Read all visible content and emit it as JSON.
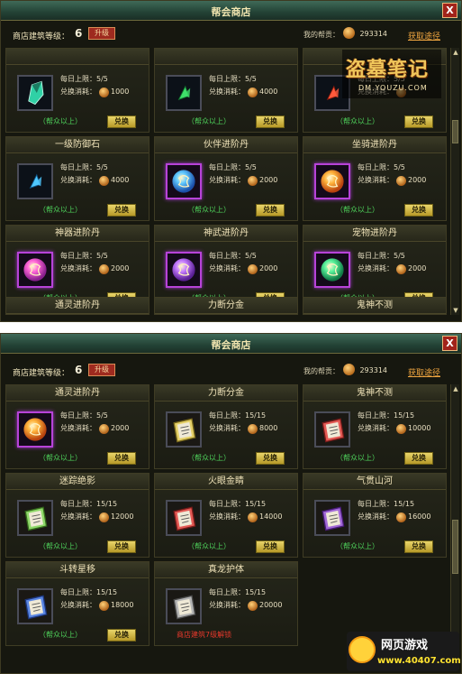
{
  "panel1": {
    "title": "帮会商店",
    "close_label": "X",
    "level_label": "商店建筑等级：",
    "level_value": "6",
    "upgrade_label": "升级",
    "money_label": "我的帮贡：",
    "money_value": "293314",
    "gain_link": "获取途径",
    "cells": [
      {
        "name": "",
        "limit": "每日上限：5/5",
        "cost_label": "兑换消耗：",
        "cost": "1000",
        "req": "（帮众以上）",
        "buy": "兑换",
        "icon": "crystal-icon",
        "frame": "plain"
      },
      {
        "name": "",
        "limit": "每日上限：5/5",
        "cost_label": "兑换消耗：",
        "cost": "4000",
        "req": "（帮众以上）",
        "buy": "兑换",
        "icon": "green-shard-icon",
        "frame": "plain"
      },
      {
        "name": "",
        "limit": "每日上限：5/5",
        "cost_label": "兑换消耗：",
        "cost": "",
        "req": "（帮众以上）",
        "buy": "兑换",
        "icon": "red-shard-icon",
        "frame": "plain"
      },
      {
        "name": "一级防御石",
        "limit": "每日上限：5/5",
        "cost_label": "兑换消耗：",
        "cost": "4000",
        "req": "（帮众以上）",
        "buy": "兑换",
        "icon": "blue-shard-icon",
        "frame": "plain"
      },
      {
        "name": "伙伴进阶丹",
        "limit": "每日上限：5/5",
        "cost_label": "兑换消耗：",
        "cost": "2000",
        "req": "（帮众以上）",
        "buy": "兑换",
        "icon": "blue-orb-icon",
        "frame": "purple"
      },
      {
        "name": "坐骑进阶丹",
        "limit": "每日上限：5/5",
        "cost_label": "兑换消耗：",
        "cost": "2000",
        "req": "（帮众以上）",
        "buy": "兑换",
        "icon": "orange-orb-icon",
        "frame": "purple"
      },
      {
        "name": "神器进阶丹",
        "limit": "每日上限：5/5",
        "cost_label": "兑换消耗：",
        "cost": "2000",
        "req": "（帮众以上）",
        "buy": "兑换",
        "icon": "magenta-orb-icon",
        "frame": "purple"
      },
      {
        "name": "神武进阶丹",
        "limit": "每日上限：5/5",
        "cost_label": "兑换消耗：",
        "cost": "2000",
        "req": "（帮众以上）",
        "buy": "兑换",
        "icon": "violet-orb-icon",
        "frame": "purple"
      },
      {
        "name": "宠物进阶丹",
        "limit": "每日上限：5/5",
        "cost_label": "兑换消耗：",
        "cost": "2000",
        "req": "（帮众以上）",
        "buy": "兑换",
        "icon": "green-orb-icon",
        "frame": "purple"
      }
    ],
    "partial_heads": [
      "通灵进阶丹",
      "力断分金",
      "鬼神不测"
    ]
  },
  "logo": {
    "main": "盗墓笔记",
    "sub": "DM.YOUZU.COM"
  },
  "panel2": {
    "title": "帮会商店",
    "close_label": "X",
    "level_label": "商店建筑等级：",
    "level_value": "6",
    "upgrade_label": "升级",
    "money_label": "我的帮贡：",
    "money_value": "293314",
    "gain_link": "获取途径",
    "cells": [
      {
        "name": "通灵进阶丹",
        "limit": "每日上限：5/5",
        "cost_label": "兑换消耗：",
        "cost": "2000",
        "req": "（帮众以上）",
        "buy": "兑换",
        "icon": "orange-orb-icon",
        "frame": "purple"
      },
      {
        "name": "力断分金",
        "limit": "每日上限：15/15",
        "cost_label": "兑换消耗：",
        "cost": "8000",
        "req": "（帮众以上）",
        "buy": "兑换",
        "icon": "yellow-book-icon",
        "frame": "plain"
      },
      {
        "name": "鬼神不测",
        "limit": "每日上限：15/15",
        "cost_label": "兑换消耗：",
        "cost": "10000",
        "req": "（帮众以上）",
        "buy": "兑换",
        "icon": "red-book-icon",
        "frame": "plain"
      },
      {
        "name": "迷踪绝影",
        "limit": "每日上限：15/15",
        "cost_label": "兑换消耗：",
        "cost": "12000",
        "req": "（帮众以上）",
        "buy": "兑换",
        "icon": "green-book-icon",
        "frame": "plain"
      },
      {
        "name": "火眼金睛",
        "limit": "每日上限：15/15",
        "cost_label": "兑换消耗：",
        "cost": "14000",
        "req": "（帮众以上）",
        "buy": "兑换",
        "icon": "red-book-icon",
        "frame": "plain"
      },
      {
        "name": "气贯山河",
        "limit": "每日上限：15/15",
        "cost_label": "兑换消耗：",
        "cost": "16000",
        "req": "（帮众以上）",
        "buy": "兑换",
        "icon": "purple-book-icon",
        "frame": "plain"
      },
      {
        "name": "斗转星移",
        "limit": "每日上限：15/15",
        "cost_label": "兑换消耗：",
        "cost": "18000",
        "req": "（帮众以上）",
        "buy": "兑换",
        "icon": "blue-book-icon",
        "frame": "plain"
      },
      {
        "name": "真龙护体",
        "limit": "每日上限：15/15",
        "cost_label": "兑换消耗：",
        "cost": "20000",
        "req": "商店建筑7级解锁",
        "buy": "",
        "icon": "grey-book-icon",
        "frame": "plain"
      }
    ]
  },
  "watermark": {
    "text": "网页游戏",
    "url": "www.40407.com"
  }
}
